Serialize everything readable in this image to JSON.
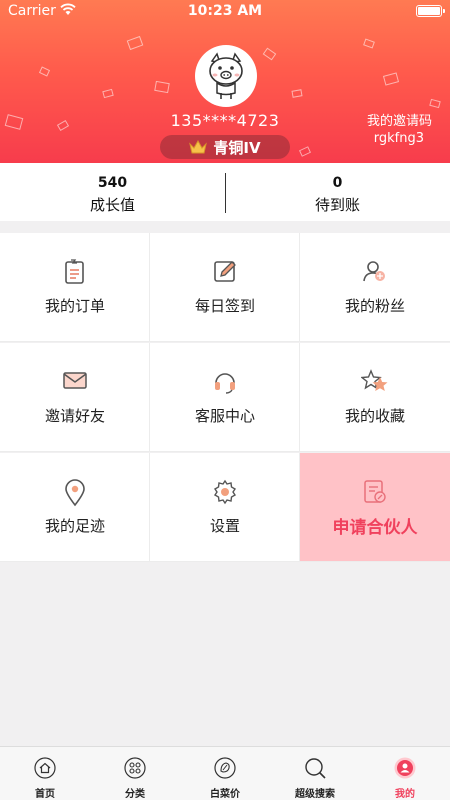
{
  "status_bar": {
    "carrier": "Carrier",
    "time": "10:23 AM"
  },
  "profile": {
    "phone": "135****4723",
    "level": "青铜IV",
    "invite_label": "我的邀请码",
    "invite_code": "rgkfng3"
  },
  "stats": [
    {
      "value": "540",
      "label": "成长值"
    },
    {
      "value": "0",
      "label": "待到账"
    }
  ],
  "menu": [
    {
      "label": "我的订单",
      "icon": "order-icon"
    },
    {
      "label": "每日签到",
      "icon": "checkin-icon"
    },
    {
      "label": "我的粉丝",
      "icon": "fans-icon"
    },
    {
      "label": "邀请好友",
      "icon": "envelope-icon"
    },
    {
      "label": "客服中心",
      "icon": "headset-icon"
    },
    {
      "label": "我的收藏",
      "icon": "star-icon"
    },
    {
      "label": "我的足迹",
      "icon": "location-icon"
    },
    {
      "label": "设置",
      "icon": "gear-icon"
    },
    {
      "label": "申请合伙人",
      "icon": "apply-icon"
    }
  ],
  "tabs": [
    {
      "label": "首页",
      "icon": "home-icon"
    },
    {
      "label": "分类",
      "icon": "category-icon"
    },
    {
      "label": "白菜价",
      "icon": "cabbage-icon"
    },
    {
      "label": "超级搜索",
      "icon": "search-icon"
    },
    {
      "label": "我的",
      "icon": "user-icon",
      "active": true
    }
  ],
  "colors": {
    "accent": "#f0415d",
    "header_top": "#ff7a52",
    "header_bottom": "#f73c4c",
    "highlight_bg": "#ffc2c7"
  }
}
